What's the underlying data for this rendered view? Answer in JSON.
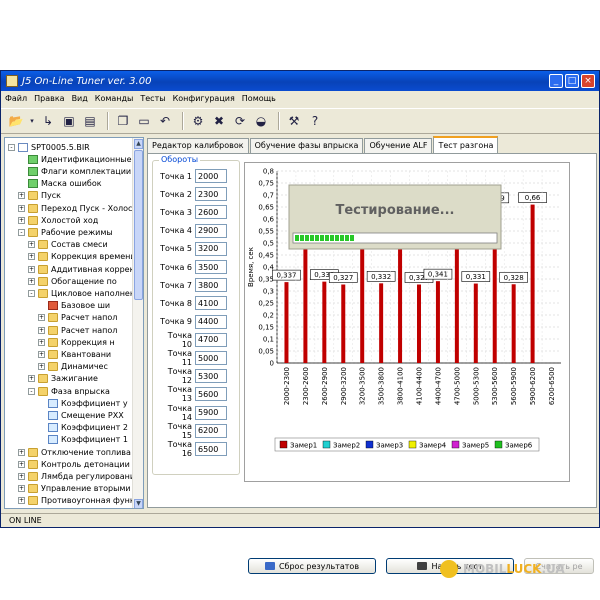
{
  "window": {
    "title": "J5 On-Line Tuner ver. 3.00"
  },
  "menu": [
    "Файл",
    "Правка",
    "Вид",
    "Команды",
    "Тесты",
    "Конфигурация",
    "Помощь"
  ],
  "toolbar_icons": [
    "open-icon",
    "dropdown-arrow-icon",
    "save-as-icon",
    "save-icon",
    "save-all-icon",
    "copy-icon",
    "paste-icon",
    "undo-icon",
    "connect-icon",
    "disconnect-icon",
    "refresh-icon",
    "car-icon",
    "tools-icon",
    "help-icon"
  ],
  "tree": [
    {
      "label": "SPT0005.5.BIR",
      "level": 0,
      "icon": "doc",
      "pm": "-"
    },
    {
      "label": "Идентификационные",
      "level": 1,
      "icon": "flag",
      "pm": ""
    },
    {
      "label": "Флаги комплектации",
      "level": 1,
      "icon": "flag",
      "pm": ""
    },
    {
      "label": "Маска ошибок",
      "level": 1,
      "icon": "flag",
      "pm": ""
    },
    {
      "label": "Пуск",
      "level": 1,
      "icon": "folder",
      "pm": "+"
    },
    {
      "label": "Переход Пуск - Холостой ход",
      "level": 1,
      "icon": "folder",
      "pm": "+"
    },
    {
      "label": "Холостой ход",
      "level": 1,
      "icon": "folder",
      "pm": "+"
    },
    {
      "label": "Рабочие режимы",
      "level": 1,
      "icon": "folder",
      "pm": "-"
    },
    {
      "label": "Состав смеси",
      "level": 2,
      "icon": "folder",
      "pm": "+"
    },
    {
      "label": "Коррекция времени",
      "level": 2,
      "icon": "folder",
      "pm": "+"
    },
    {
      "label": "Аддитивная коррекция",
      "level": 2,
      "icon": "folder",
      "pm": "+"
    },
    {
      "label": "Обогащение по",
      "level": 2,
      "icon": "folder",
      "pm": "+"
    },
    {
      "label": "Цикловое наполнение",
      "level": 2,
      "icon": "folder",
      "pm": "-"
    },
    {
      "label": "Базовое ши",
      "level": 3,
      "icon": "red",
      "pm": ""
    },
    {
      "label": "Расчет напол",
      "level": 3,
      "icon": "folder",
      "pm": "+"
    },
    {
      "label": "Расчет напол",
      "level": 3,
      "icon": "folder",
      "pm": "+"
    },
    {
      "label": "Коррекция н",
      "level": 3,
      "icon": "folder",
      "pm": "+"
    },
    {
      "label": "Квантовани",
      "level": 3,
      "icon": "folder",
      "pm": "+"
    },
    {
      "label": "Динамичес",
      "level": 3,
      "icon": "folder",
      "pm": "+"
    },
    {
      "label": "Зажигание",
      "level": 2,
      "icon": "folder",
      "pm": "+"
    },
    {
      "label": "Фаза впрыска",
      "level": 2,
      "icon": "folder",
      "pm": "-"
    },
    {
      "label": "Коэффициент у",
      "level": 3,
      "icon": "leaf",
      "pm": ""
    },
    {
      "label": "Смещение РХХ",
      "level": 3,
      "icon": "leaf",
      "pm": ""
    },
    {
      "label": "Коэффициент 2",
      "level": 3,
      "icon": "leaf",
      "pm": ""
    },
    {
      "label": "Коэффициент 1",
      "level": 3,
      "icon": "leaf",
      "pm": ""
    },
    {
      "label": "Отключение топлива",
      "level": 1,
      "icon": "folder",
      "pm": "+"
    },
    {
      "label": "Контроль детонации",
      "level": 1,
      "icon": "folder",
      "pm": "+"
    },
    {
      "label": "Лямбда регулирование",
      "level": 1,
      "icon": "folder",
      "pm": "+"
    },
    {
      "label": "Управление вторыми",
      "level": 1,
      "icon": "folder",
      "pm": "+"
    },
    {
      "label": "Противоугонная функция",
      "level": 1,
      "icon": "folder",
      "pm": "+"
    }
  ],
  "tabs": [
    "Редактор калибровок",
    "Обучение фазы впрыска",
    "Обучение ALF",
    "Тест разгона"
  ],
  "group_title": "Обороты",
  "points": [
    {
      "label": "Точка 1",
      "value": "2000"
    },
    {
      "label": "Точка 2",
      "value": "2300"
    },
    {
      "label": "Точка 3",
      "value": "2600"
    },
    {
      "label": "Точка 4",
      "value": "2900"
    },
    {
      "label": "Точка 5",
      "value": "3200"
    },
    {
      "label": "Точка 6",
      "value": "3500"
    },
    {
      "label": "Точка 7",
      "value": "3800"
    },
    {
      "label": "Точка 8",
      "value": "4100"
    },
    {
      "label": "Точка 9",
      "value": "4400"
    },
    {
      "label": "Точка 10",
      "value": "4700"
    },
    {
      "label": "Точка 11",
      "value": "5000"
    },
    {
      "label": "Точка 12",
      "value": "5300"
    },
    {
      "label": "Точка 13",
      "value": "5600"
    },
    {
      "label": "Точка 14",
      "value": "5900"
    },
    {
      "label": "Точка 15",
      "value": "6200"
    },
    {
      "label": "Точка 16",
      "value": "6500"
    }
  ],
  "progress": {
    "label": "Тестирование...",
    "fraction": 0.32
  },
  "buttons": {
    "reset": "Сброс результатов",
    "start": "Начать тест",
    "read": "Считать ре"
  },
  "status": "ON LINE",
  "watermark": {
    "part1": "MOBIL",
    "part2": "LUCK",
    "part3": ".UA"
  },
  "colors": {
    "bar": "#c00000",
    "titlebar": "#0a5ee8",
    "progress": "#28c828"
  },
  "chart_data": {
    "type": "bar",
    "ylabel": "Время, сек",
    "ylim": [
      0,
      0.8
    ],
    "yticks": [
      "0",
      "0,05",
      "0,1",
      "0,15",
      "0,2",
      "0,25",
      "0,3",
      "0,35",
      "0,4",
      "0,45",
      "0,5",
      "0,55",
      "0,6",
      "0,65",
      "0,7",
      "0,75",
      "0,8"
    ],
    "categories": [
      "2000-2300",
      "2300-2600",
      "2600-2900",
      "2900-3200",
      "3200-3500",
      "3500-3800",
      "3800-4100",
      "4100-4400",
      "4400-4700",
      "4700-5000",
      "5000-5300",
      "5300-5600",
      "5600-5900",
      "5900-6200",
      "6200-6500"
    ],
    "series": [
      {
        "name": "Замер1",
        "values": [
          0.337,
          0.72,
          0.339,
          0.327,
          0.72,
          0.332,
          0.72,
          0.327,
          0.341,
          0.72,
          0.331,
          0.659,
          0.328,
          0.66,
          null
        ],
        "labels": [
          "0,337",
          "",
          "0,339",
          "0,327",
          "",
          "0,332",
          "",
          "0,327",
          "0,341",
          "",
          "0,331",
          "0,659",
          "0,328",
          "0,66",
          ""
        ]
      }
    ],
    "legend": [
      {
        "name": "Замер1",
        "color": "#c00000"
      },
      {
        "name": "Замер2",
        "color": "#20d0d0"
      },
      {
        "name": "Замер3",
        "color": "#1030d0"
      },
      {
        "name": "Замер4",
        "color": "#f0f000"
      },
      {
        "name": "Замер5",
        "color": "#d020d0"
      },
      {
        "name": "Замер6",
        "color": "#20c020"
      }
    ],
    "legend_position": "bottom",
    "grid": true
  }
}
